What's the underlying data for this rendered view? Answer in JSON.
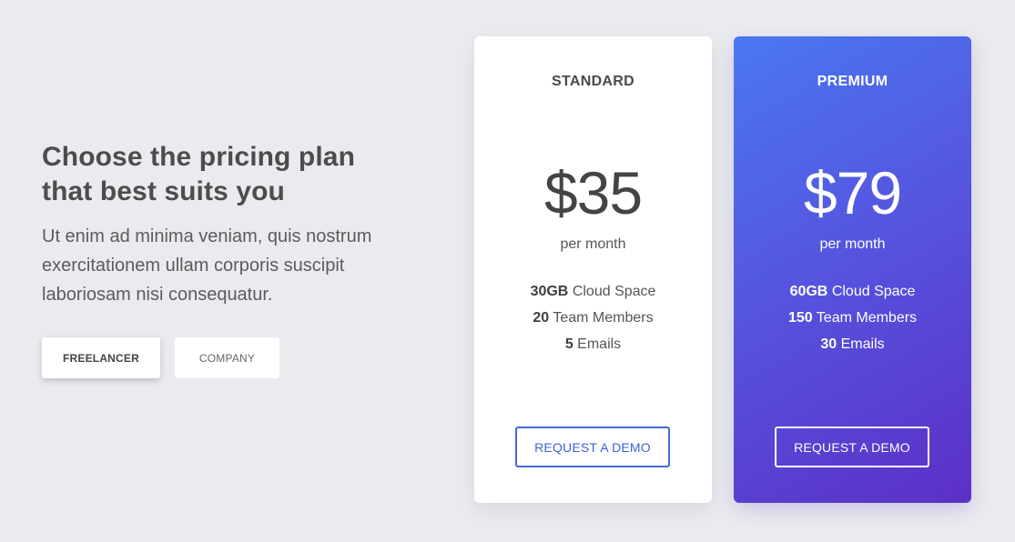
{
  "intro": {
    "heading": "Choose the pricing plan that best suits you",
    "description": "Ut enim ad minima veniam, quis nostrum exercitationem ullam corporis suscipit laboriosam nisi consequatur."
  },
  "toggle": {
    "options": [
      {
        "label": "FREELANCER",
        "selected": true
      },
      {
        "label": "COMPANY",
        "selected": false
      }
    ]
  },
  "plans": [
    {
      "name": "STANDARD",
      "price": "$35",
      "period": "per month",
      "features": [
        {
          "value": "30GB",
          "label": "Cloud Space"
        },
        {
          "value": "20",
          "label": "Team Members"
        },
        {
          "value": "5",
          "label": "Emails"
        }
      ],
      "cta": "REQUEST A DEMO"
    },
    {
      "name": "PREMIUM",
      "price": "$79",
      "period": "per month",
      "features": [
        {
          "value": "60GB",
          "label": "Cloud Space"
        },
        {
          "value": "150",
          "label": "Team Members"
        },
        {
          "value": "30",
          "label": "Emails"
        }
      ],
      "cta": "REQUEST A DEMO"
    }
  ],
  "colors": {
    "background": "#eaebef",
    "accent_blue": "#4369d9",
    "premium_gradient_start": "#4a78f0",
    "premium_gradient_end": "#5c2fc6"
  }
}
